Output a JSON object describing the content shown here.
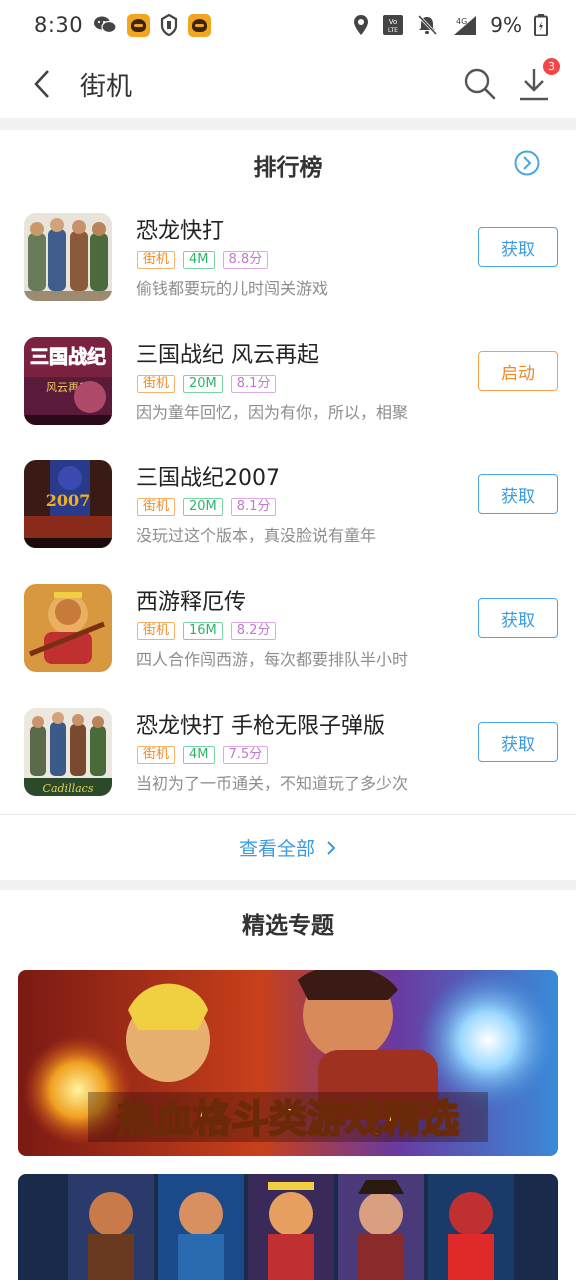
{
  "status_bar": {
    "time": "8:30",
    "battery": "9%"
  },
  "nav": {
    "title": "街机",
    "download_badge": "3"
  },
  "ranking": {
    "title": "排行榜",
    "apps": [
      {
        "name": "恐龙快打",
        "category": "街机",
        "size": "4M",
        "score": "8.8分",
        "desc": "偷钱都要玩的儿时闯关游戏",
        "action": "获取"
      },
      {
        "name": "三国战纪 风云再起",
        "category": "街机",
        "size": "20M",
        "score": "8.1分",
        "desc": "因为童年回忆，因为有你，所以，相聚",
        "action": "启动"
      },
      {
        "name": "三国战纪2007",
        "category": "街机",
        "size": "20M",
        "score": "8.1分",
        "desc": "没玩过这个版本，真没脸说有童年",
        "action": "获取"
      },
      {
        "name": "西游释厄传",
        "category": "街机",
        "size": "16M",
        "score": "8.2分",
        "desc": "四人合作闯西游，每次都要排队半小时",
        "action": "获取"
      },
      {
        "name": "恐龙快打 手枪无限子弹版",
        "category": "街机",
        "size": "4M",
        "score": "7.5分",
        "desc": "当初为了一币通关，不知道玩了多少次",
        "action": "获取"
      }
    ],
    "view_all": "查看全部"
  },
  "featured": {
    "title": "精选专题",
    "banner1_text": "热血格斗类游戏精选"
  },
  "colors": {
    "accent_blue": "#3a9be0",
    "orange": "#f08a24",
    "green": "#2db46c",
    "purple": "#c377cf"
  }
}
